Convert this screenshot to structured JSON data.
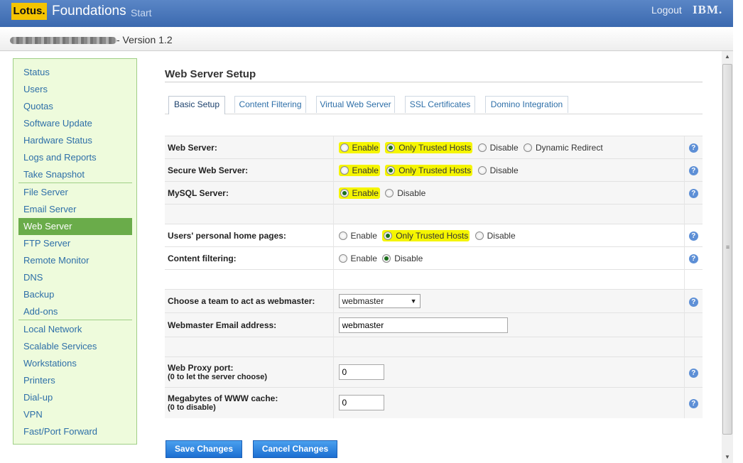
{
  "header": {
    "logo": "Lotus.",
    "title": "Foundations",
    "subtitle": "Start",
    "logout": "Logout",
    "ibm": "IBM."
  },
  "subheader": {
    "version": " - Version 1.2"
  },
  "sidebar": {
    "groups": [
      [
        "Status",
        "Users",
        "Quotas",
        "Software Update",
        "Hardware Status",
        "Logs and Reports",
        "Take Snapshot"
      ],
      [
        "File Server",
        "Email Server",
        "Web Server",
        "FTP Server",
        "Remote Monitor",
        "DNS",
        "Backup",
        "Add-ons"
      ],
      [
        "Local Network",
        "Scalable Services",
        "Workstations",
        "Printers",
        "Dial-up",
        "VPN",
        "Fast/Port Forward"
      ]
    ],
    "active": "Web Server"
  },
  "page": {
    "title": "Web Server Setup"
  },
  "tabs": [
    "Basic Setup",
    "Content Filtering",
    "Virtual Web Server",
    "SSL Certificates",
    "Domino Integration"
  ],
  "settings": {
    "web_server": {
      "label": "Web Server:",
      "options": [
        "Enable",
        "Only Trusted Hosts",
        "Disable",
        "Dynamic Redirect"
      ],
      "selected": "Only Trusted Hosts"
    },
    "secure_web_server": {
      "label": "Secure Web Server:",
      "options": [
        "Enable",
        "Only Trusted Hosts",
        "Disable"
      ],
      "selected": "Only Trusted Hosts"
    },
    "mysql_server": {
      "label": "MySQL Server:",
      "options": [
        "Enable",
        "Disable"
      ],
      "selected": "Enable"
    },
    "personal_pages": {
      "label": "Users' personal home pages:",
      "options": [
        "Enable",
        "Only Trusted Hosts",
        "Disable"
      ],
      "selected": "Only Trusted Hosts"
    },
    "content_filtering": {
      "label": "Content filtering:",
      "options": [
        "Enable",
        "Disable"
      ],
      "selected": "Disable"
    },
    "webmaster_team": {
      "label": "Choose a team to act as webmaster:",
      "value": "webmaster"
    },
    "webmaster_email": {
      "label": "Webmaster Email address:",
      "value": "webmaster"
    },
    "proxy_port": {
      "label": "Web Proxy port:",
      "note": "(0 to let the server choose)",
      "value": "0"
    },
    "www_cache": {
      "label": "Megabytes of WWW cache:",
      "note": "(0 to disable)",
      "value": "0"
    },
    "help_glyph": "?"
  },
  "buttons": {
    "save": "Save Changes",
    "cancel": "Cancel Changes"
  },
  "colors": {
    "header": "#3b69af",
    "sidebar_bg": "#eefbdc",
    "active_nav": "#6aac4a",
    "highlight": "#f5f500",
    "button": "#1c6fd2"
  }
}
